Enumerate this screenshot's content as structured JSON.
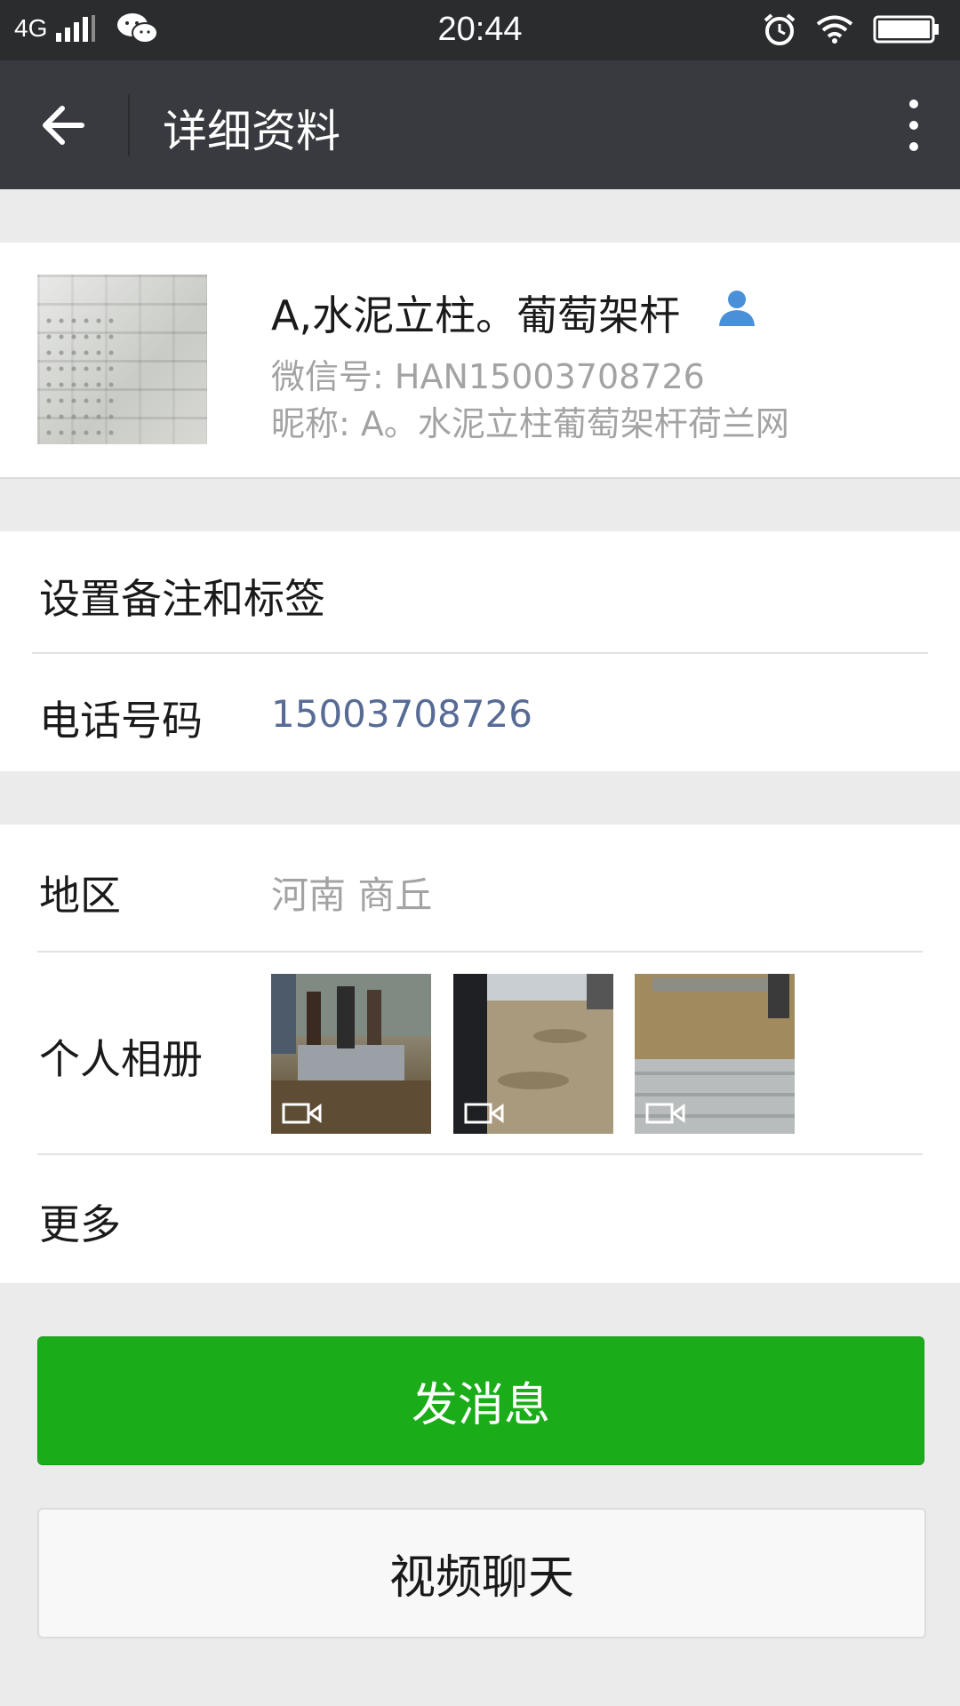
{
  "status_bar": {
    "network": "4G",
    "time": "20:44",
    "icons": [
      "signal-icon",
      "wechat-icon",
      "alarm-icon",
      "wifi-icon",
      "battery-icon"
    ]
  },
  "header": {
    "title": "详细资料",
    "icons": [
      "back-arrow-icon",
      "more-vertical-icon"
    ]
  },
  "profile": {
    "name": "A,水泥立柱。葡萄架杆",
    "wechat_id": "微信号: HAN15003708726",
    "nickname": "昵称: A。水泥立柱葡萄架杆荷兰网",
    "icon": "person-icon"
  },
  "rows": {
    "remark": {
      "label": "设置备注和标签"
    },
    "phone": {
      "label": "电话号码",
      "value": "15003708726"
    },
    "region": {
      "label": "地区",
      "value": "河南  商丘"
    },
    "album": {
      "label": "个人相册",
      "thumbnails": [
        "video-thumbnail",
        "video-thumbnail",
        "video-thumbnail"
      ]
    },
    "more": {
      "label": "更多"
    }
  },
  "buttons": {
    "send_message": "发消息",
    "video_chat": "视频聊天"
  },
  "colors": {
    "status_bar": "#2b2c2e",
    "header": "#393a3f",
    "link": "#576b95",
    "primary": "#1aad19",
    "secondary_text": "#a3a3a3"
  }
}
